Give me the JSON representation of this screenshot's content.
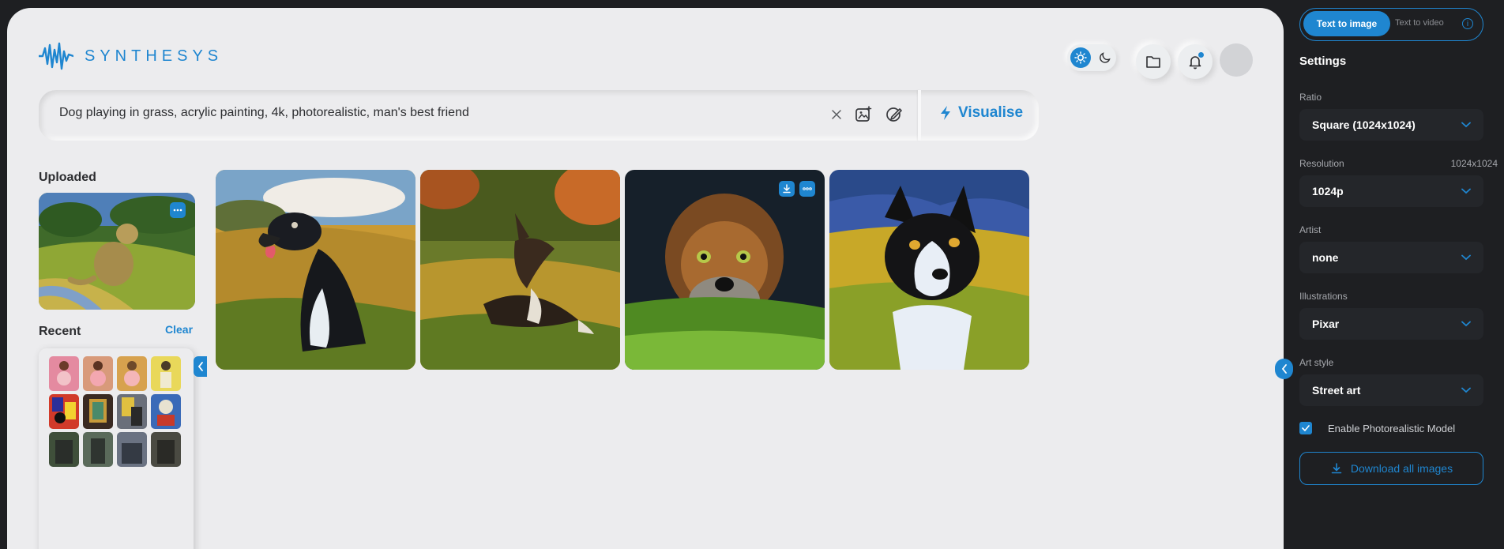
{
  "brand": {
    "name": "SYNTHESYS"
  },
  "header": {
    "theme_light_icon": "sun-icon",
    "theme_dark_icon": "moon-icon",
    "folder_icon": "folder-icon",
    "bell_icon": "bell-icon",
    "avatar": "avatar"
  },
  "prompt": {
    "text": "Dog playing in grass, acrylic painting, 4k, photorealistic, man's best friend",
    "clear_icon": "close-icon",
    "add_image_icon": "add-image-icon",
    "edit_icon": "edit-brush-icon",
    "visualise_label": "Visualise"
  },
  "uploaded": {
    "title": "Uploaded"
  },
  "recent": {
    "title": "Recent",
    "clear_label": "Clear"
  },
  "sidebar": {
    "tabs": {
      "active": "Text to image",
      "inactive": "Text to video"
    },
    "settings_title": "Settings",
    "ratio": {
      "label": "Ratio",
      "value": "Square (1024x1024)"
    },
    "resolution": {
      "label": "Resolution",
      "hint": "1024x1024",
      "value": "1024p"
    },
    "artist": {
      "label": "Artist",
      "value": "none"
    },
    "illustrations": {
      "label": "Illustrations",
      "value": "Pixar"
    },
    "art_style": {
      "label": "Art style",
      "value": "Street art"
    },
    "photorealistic": {
      "label": "Enable Photorealistic Model",
      "checked": true
    },
    "download_all": "Download all images"
  },
  "colors": {
    "accent": "#1f86d0",
    "panel": "#ececee",
    "dark": "#1e1f22"
  }
}
